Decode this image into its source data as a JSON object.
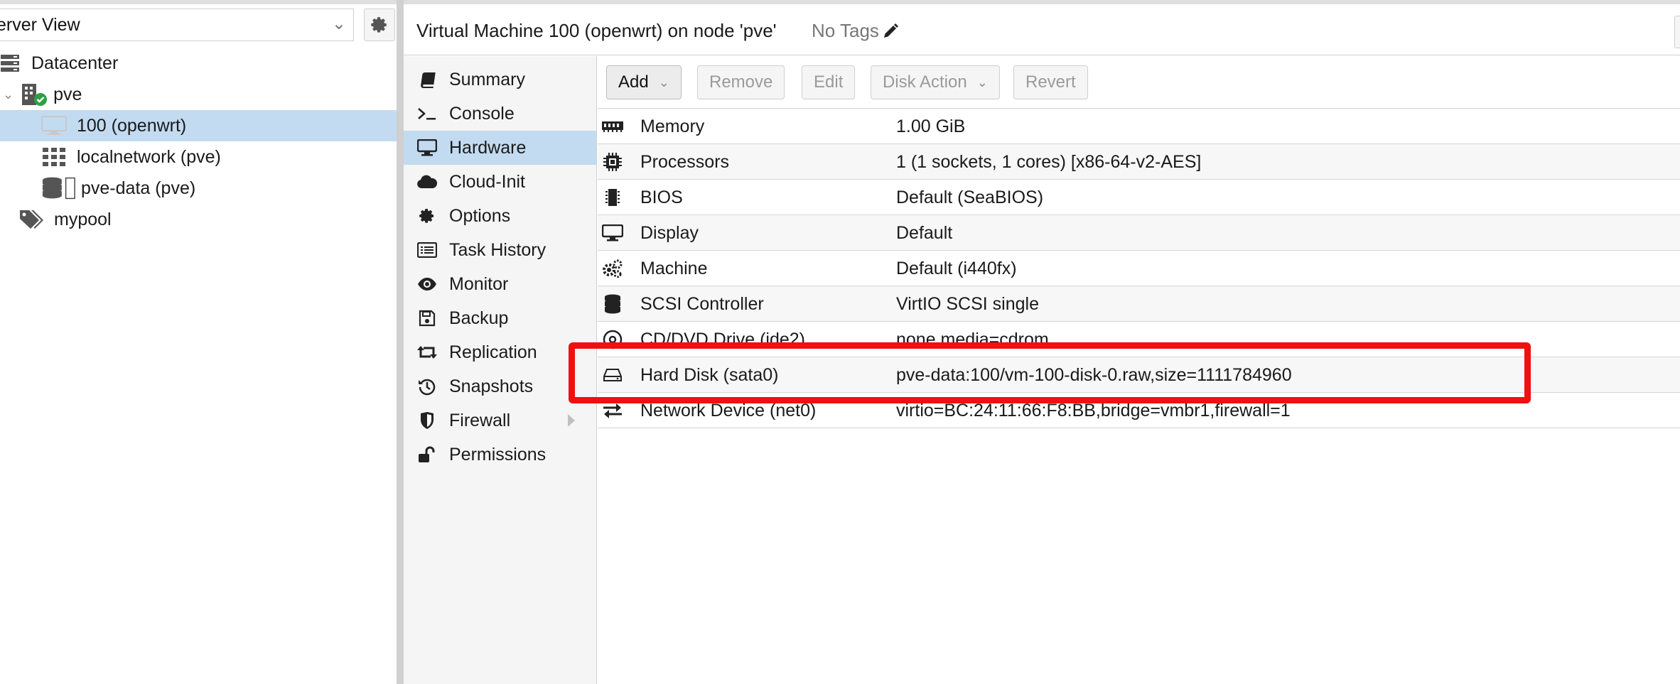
{
  "tree": {
    "view_label": "erver View",
    "items": [
      {
        "label": "Datacenter",
        "icon": "server-icon"
      },
      {
        "label": "pve",
        "icon": "node-online-icon"
      },
      {
        "label": "100 (openwrt)",
        "icon": "vm-monitor-icon"
      },
      {
        "label": "localnetwork (pve)",
        "icon": "grid-icon"
      },
      {
        "label": "pve-data (pve)",
        "icon": "storage-icon"
      },
      {
        "label": "mypool",
        "icon": "tags-icon"
      }
    ]
  },
  "header": {
    "title": "Virtual Machine 100 (openwrt) on node 'pve'",
    "tags": "No Tags"
  },
  "nav": {
    "items": [
      {
        "label": "Summary",
        "icon": "book-icon"
      },
      {
        "label": "Console",
        "icon": "terminal-icon"
      },
      {
        "label": "Hardware",
        "icon": "desktop-icon"
      },
      {
        "label": "Cloud-Init",
        "icon": "cloud-icon"
      },
      {
        "label": "Options",
        "icon": "gear-icon"
      },
      {
        "label": "Task History",
        "icon": "list-icon"
      },
      {
        "label": "Monitor",
        "icon": "eye-icon"
      },
      {
        "label": "Backup",
        "icon": "floppy-icon"
      },
      {
        "label": "Replication",
        "icon": "retweet-icon"
      },
      {
        "label": "Snapshots",
        "icon": "history-icon"
      },
      {
        "label": "Firewall",
        "icon": "shield-icon"
      },
      {
        "label": "Permissions",
        "icon": "unlock-icon"
      }
    ]
  },
  "toolbar": {
    "add": "Add",
    "remove": "Remove",
    "edit": "Edit",
    "disk_action": "Disk Action",
    "revert": "Revert"
  },
  "hardware": {
    "rows": [
      {
        "name": "Memory",
        "value": "1.00 GiB",
        "icon": "memory-icon"
      },
      {
        "name": "Processors",
        "value": "1 (1 sockets, 1 cores) [x86-64-v2-AES]",
        "icon": "cpu-icon"
      },
      {
        "name": "BIOS",
        "value": "Default (SeaBIOS)",
        "icon": "chip-icon"
      },
      {
        "name": "Display",
        "value": "Default",
        "icon": "desktop-icon"
      },
      {
        "name": "Machine",
        "value": "Default (i440fx)",
        "icon": "cogs-icon"
      },
      {
        "name": "SCSI Controller",
        "value": "VirtIO SCSI single",
        "icon": "database-icon"
      },
      {
        "name": "CD/DVD Drive (ide2)",
        "value": "none,media=cdrom",
        "icon": "cdrom-icon"
      },
      {
        "name": "Hard Disk (sata0)",
        "value": "pve-data:100/vm-100-disk-0.raw,size=1111784960",
        "icon": "hdd-icon"
      },
      {
        "name": "Network Device (net0)",
        "value": "virtio=BC:24:11:66:F8:BB,bridge=vmbr1,firewall=1",
        "icon": "exchange-icon"
      }
    ]
  },
  "colors": {
    "selection": "#c2dbf1",
    "highlight": "#f01010",
    "online": "#2ea043"
  }
}
